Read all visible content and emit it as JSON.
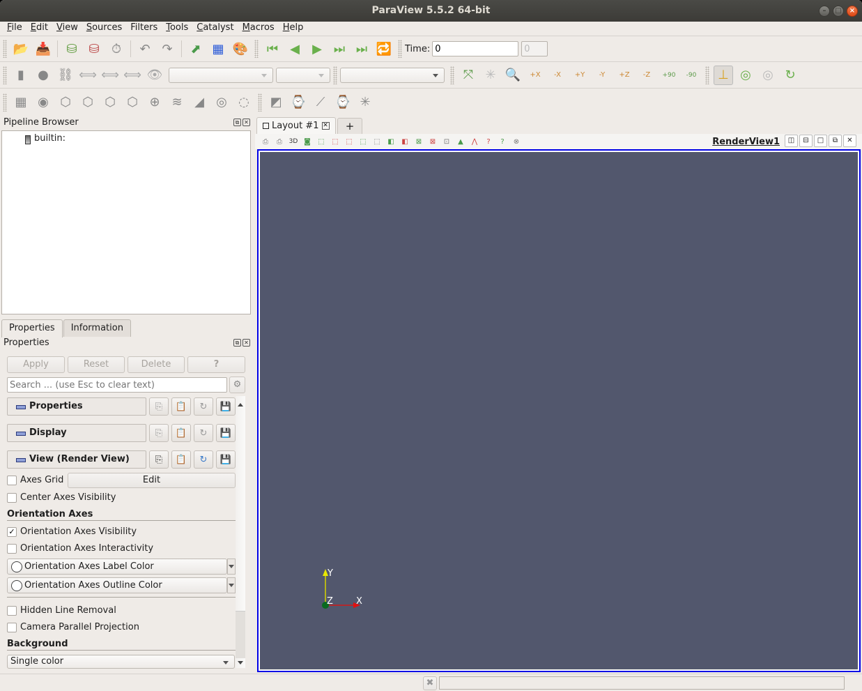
{
  "window": {
    "title": "ParaView 5.5.2 64-bit",
    "controls": [
      "minimize",
      "maximize",
      "close"
    ]
  },
  "menubar": [
    {
      "label": "File",
      "u": "F",
      "rest": "ile"
    },
    {
      "label": "Edit",
      "u": "E",
      "rest": "dit"
    },
    {
      "label": "View",
      "u": "V",
      "rest": "iew"
    },
    {
      "label": "Sources",
      "u": "S",
      "rest": "ources"
    },
    {
      "label": "Filters",
      "u": "",
      "rest": "Filters"
    },
    {
      "label": "Tools",
      "u": "T",
      "rest": "ools"
    },
    {
      "label": "Catalyst",
      "u": "C",
      "rest": "atalyst"
    },
    {
      "label": "Macros",
      "u": "M",
      "rest": "acros"
    },
    {
      "label": "Help",
      "u": "H",
      "rest": "elp"
    }
  ],
  "toolbar_main": {
    "time_label": "Time:",
    "time_value": "0",
    "timestep_value": "0"
  },
  "camera": {
    "labels": [
      "+X",
      "-X",
      "+Y",
      "-Y",
      "+Z",
      "-Z",
      "+90",
      "-90"
    ]
  },
  "pipeline_browser": {
    "title": "Pipeline Browser",
    "items": [
      {
        "label": "builtin:"
      }
    ]
  },
  "tabs": [
    "Properties",
    "Information"
  ],
  "properties": {
    "title": "Properties",
    "buttons": {
      "apply": "Apply",
      "reset": "Reset",
      "delete": "Delete",
      "help": "?"
    },
    "search_placeholder": "Search ... (use Esc to clear text)",
    "sections": [
      "Properties",
      "Display",
      "View (Render View)"
    ],
    "axes_grid": {
      "label": "Axes Grid",
      "checked": false,
      "edit": "Edit"
    },
    "center_axes": {
      "label": "Center Axes Visibility",
      "checked": false
    },
    "orientation_group": "Orientation Axes",
    "orientation_visibility": {
      "label": "Orientation Axes Visibility",
      "checked": true,
      "mark": "✓"
    },
    "orientation_interactivity": {
      "label": "Orientation Axes Interactivity",
      "checked": false
    },
    "label_color": "Orientation Axes Label Color",
    "outline_color": "Orientation Axes Outline Color",
    "hidden_line": {
      "label": "Hidden Line Removal",
      "checked": false
    },
    "parallel_projection": {
      "label": "Camera Parallel Projection",
      "checked": false
    },
    "background_group": "Background",
    "background_value": "Single color"
  },
  "layout": {
    "tab_label": "Layout #1",
    "add_tab": "+",
    "view_name": "RenderView1",
    "view_3d": "3D"
  },
  "render": {
    "background": "#52576d",
    "axes": {
      "x": "X",
      "y": "Y",
      "z": "Z"
    }
  }
}
